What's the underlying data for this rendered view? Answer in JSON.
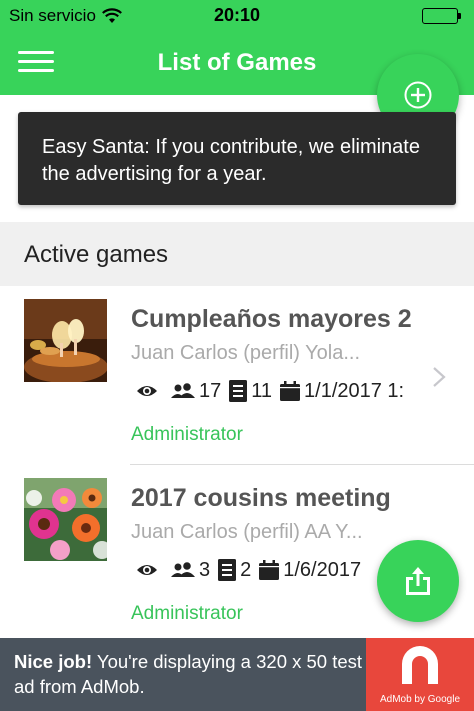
{
  "status_bar": {
    "carrier": "Sin servicio",
    "time": "20:10"
  },
  "header": {
    "title": "List of Games"
  },
  "banner": {
    "text": "Easy Santa: If you contribute, we eliminate the advertising for a year."
  },
  "section": {
    "title": "Active games"
  },
  "games": [
    {
      "title": "Cumpleaños mayores 2",
      "players": "Juan Carlos (perfil) Yola...",
      "participants": "17",
      "lists": "11",
      "date": "1/1/2017 1:",
      "role": "Administrator"
    },
    {
      "title": "2017 cousins meeting",
      "players": "Juan Carlos (perfil) AA Y...",
      "participants": "3",
      "lists": "2",
      "date": "1/6/2017",
      "role": "Administrator"
    }
  ],
  "ad": {
    "bold": "Nice job!",
    "text": " You're displaying a 320 x 50 test ad from AdMob.",
    "brand": "AdMob by Google"
  },
  "colors": {
    "primary": "#38d35a",
    "banner_bg": "#2b2b2b",
    "ad_bg": "#4a535d",
    "ad_logo": "#e8473c"
  },
  "icons": [
    "wifi-icon",
    "battery-icon",
    "menu-icon",
    "add-icon",
    "eye-icon",
    "group-icon",
    "list-icon",
    "calendar-icon",
    "chevron-right-icon",
    "share-icon"
  ]
}
